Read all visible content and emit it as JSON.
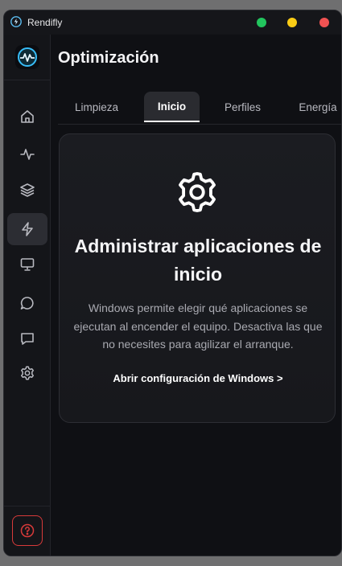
{
  "window": {
    "title": "Rendifly"
  },
  "titlebar_buttons": [
    {
      "name": "green",
      "color": "#22c55e"
    },
    {
      "name": "yellow",
      "color": "#facc15"
    },
    {
      "name": "red",
      "color": "#f05252"
    }
  ],
  "sidebar": {
    "items": [
      {
        "icon": "home-icon",
        "active": false
      },
      {
        "icon": "activity-icon",
        "active": false
      },
      {
        "icon": "layers-icon",
        "active": false
      },
      {
        "icon": "lightning-icon",
        "active": true
      },
      {
        "icon": "monitor-icon",
        "active": false
      },
      {
        "icon": "chat-circle-icon",
        "active": false
      },
      {
        "icon": "chat-square-icon",
        "active": false
      },
      {
        "icon": "gear-icon",
        "active": false
      }
    ],
    "help_icon": "help-icon"
  },
  "main": {
    "title": "Optimización",
    "tabs": [
      {
        "label": "Limpieza",
        "active": false
      },
      {
        "label": "Inicio",
        "active": true
      },
      {
        "label": "Perfiles",
        "active": false
      },
      {
        "label": "Energía",
        "active": false
      }
    ],
    "card": {
      "icon": "gear-icon",
      "title": "Administrar aplicaciones de inicio",
      "description": "Windows permite elegir qué aplicaciones se ejecutan al encender el equipo. Desactiva las que no necesites para agilizar el arranque.",
      "link": "Abrir configuración de Windows >"
    }
  },
  "colors": {
    "accent_help": "#d83a3a",
    "logo_accent": "#38bdf8"
  }
}
